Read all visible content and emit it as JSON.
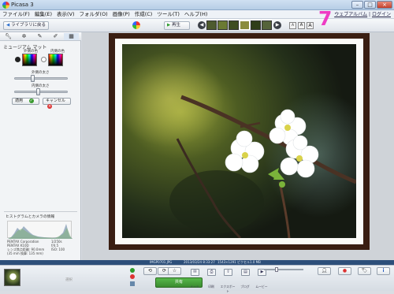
{
  "window": {
    "title": "Picasa 3",
    "controls": [
      "–",
      "□",
      "×"
    ]
  },
  "menu": {
    "items": [
      "ファイル(F)",
      "編集(E)",
      "表示(V)",
      "フォルダ(O)",
      "画像(P)",
      "作成(C)",
      "ツール(T)",
      "ヘルプ(H)"
    ],
    "right_links": [
      "ウェブアルバム",
      "ログイン"
    ]
  },
  "toolbar": {
    "back_label": "ライブラリに戻る",
    "play_label": "再生",
    "overlay_number": "7",
    "size_buttons": [
      "A",
      "A",
      "A"
    ]
  },
  "left_panel": {
    "tabs": [
      "wrench-icon",
      "tune-icon",
      "brush-icon",
      "brush2-icon",
      "film-icon"
    ],
    "title": "ミュージアム マット",
    "outer_color_label": "外側の色",
    "inner_color_label": "内側の色",
    "outer_width_label": "外側の太さ",
    "inner_width_label": "内側の太さ",
    "outer_width": 0.35,
    "inner_width": 0.45,
    "apply_label": "適用",
    "cancel_label": "キャンセル",
    "histogram_title": "ヒストグラムとカメラの情報",
    "camera_info": [
      [
        "PENTAX Corporation",
        "1/250s"
      ],
      [
        "PENTAX K10D",
        "f/4.5"
      ],
      [
        "レンズ焦点距離: 90.0mm",
        "ISO: 100"
      ],
      [
        "(35 mm 換算: 135 mm)",
        ""
      ]
    ]
  },
  "photo": {
    "frame_color": "#3a1e12",
    "mat_color": "#fbfbf8"
  },
  "status": {
    "filename": "IMGP0701.JPG",
    "date": "2013/03/24 8:33:27",
    "dimensions": "1543×1291 ピクセル",
    "size": "1.0 MB"
  },
  "bottom": {
    "tray_label": "選択",
    "share_label": "共有",
    "actions": [
      "メール",
      "印刷",
      "エクスポート",
      "ブログ",
      "ムービー"
    ]
  }
}
